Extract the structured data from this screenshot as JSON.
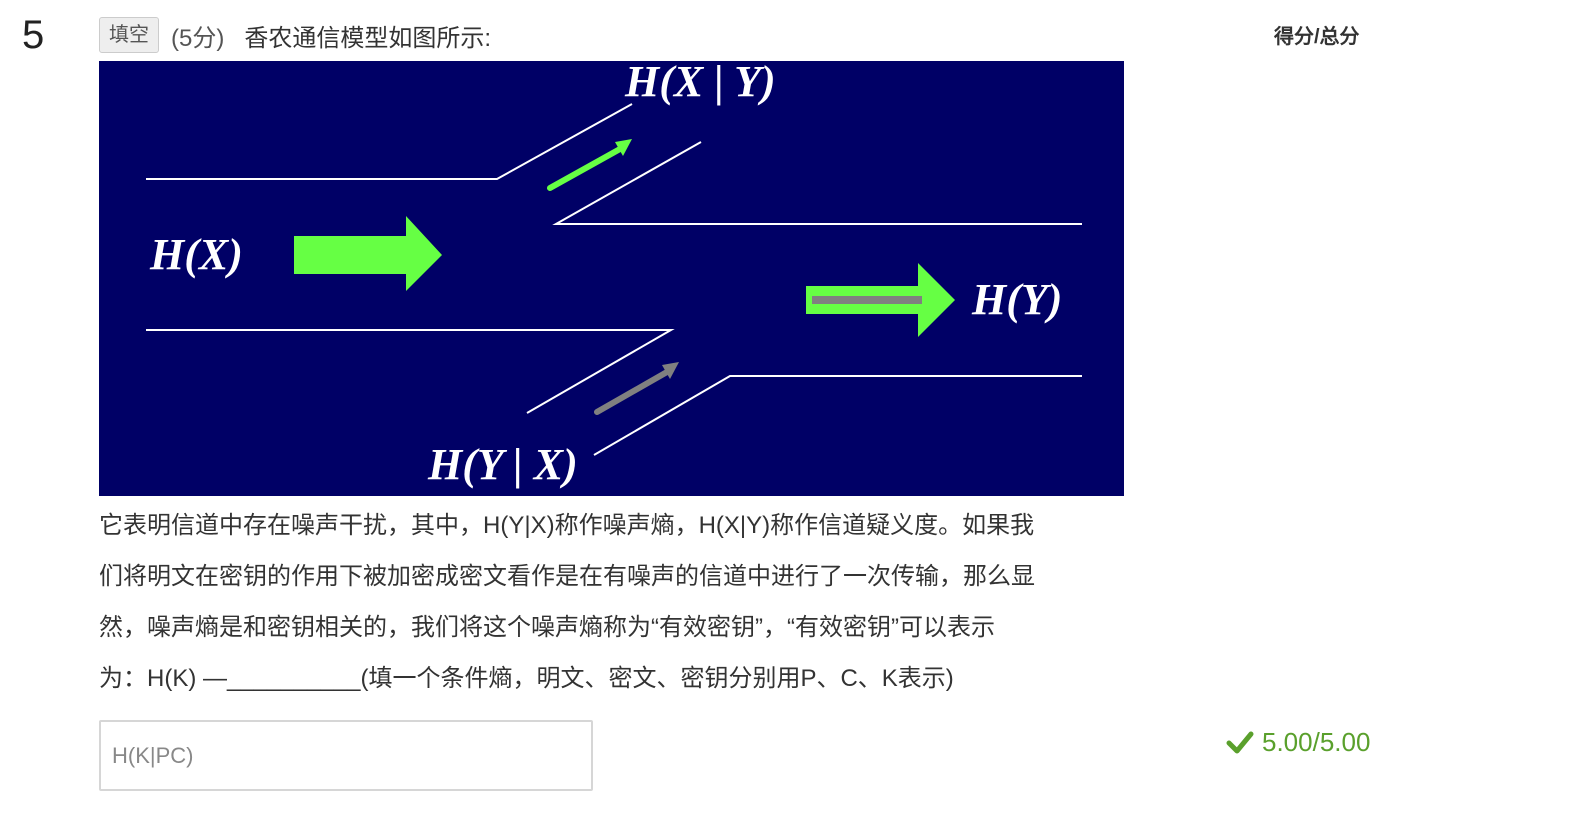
{
  "question": {
    "number": "5",
    "type_badge": "填空",
    "points": "(5分)",
    "title": "香农通信模型如图所示:"
  },
  "score_header": "得分/总分",
  "figure": {
    "labels": {
      "hx": "H(X)",
      "hy": "H(Y)",
      "hxy": "H(X | Y)",
      "hyx": "H(Y | X)"
    },
    "colors": {
      "background": "#000066",
      "arrow_green": "#66ff44",
      "arrow_gray": "#808080",
      "line_white": "#ffffff"
    }
  },
  "body_lines": [
    "它表明信道中存在噪声干扰，其中，H(Y|X)称作噪声熵，H(X|Y)称作信道疑义度。如果我",
    "们将明文在密钥的作用下被加密成密文看作是在有噪声的信道中进行了一次传输，那么显",
    "然，噪声熵是和密钥相关的，我们将这个噪声熵称为“有效密钥”，“有效密钥”可以表示",
    "为：H(K) —__________(填一个条件熵，明文、密文、密钥分别用P、C、K表示)"
  ],
  "answer": {
    "value": "H(K|PC)"
  },
  "result": {
    "icon": "check-icon",
    "score": "5.00/5.00",
    "color": "#5aa02c"
  }
}
